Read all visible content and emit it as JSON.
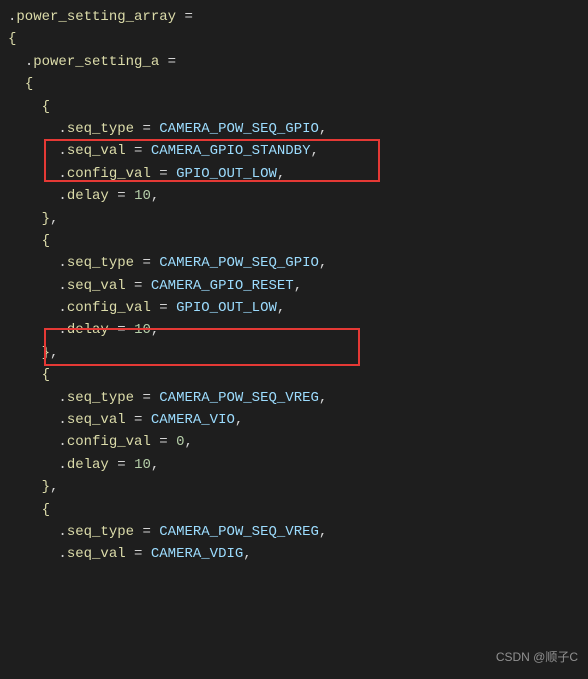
{
  "lines": [
    {
      "indent": 0,
      "type": "assign",
      "member": "power_setting_array"
    },
    {
      "indent": 0,
      "type": "open-brace"
    },
    {
      "indent": 1,
      "type": "assign",
      "member": "power_setting_a"
    },
    {
      "indent": 1,
      "type": "open-brace"
    },
    {
      "indent": 2,
      "type": "open-brace"
    },
    {
      "indent": 3,
      "type": "kv",
      "member": "seq_type",
      "value": "CAMERA_POW_SEQ_GPIO"
    },
    {
      "indent": 3,
      "type": "kv",
      "member": "seq_val",
      "value": "CAMERA_GPIO_STANDBY"
    },
    {
      "indent": 3,
      "type": "kv",
      "member": "config_val",
      "value": "GPIO_OUT_LOW"
    },
    {
      "indent": 3,
      "type": "kvnum",
      "member": "delay",
      "value": "10"
    },
    {
      "indent": 2,
      "type": "close-brace-comma"
    },
    {
      "indent": 2,
      "type": "open-brace"
    },
    {
      "indent": 3,
      "type": "kv",
      "member": "seq_type",
      "value": "CAMERA_POW_SEQ_GPIO"
    },
    {
      "indent": 3,
      "type": "kv",
      "member": "seq_val",
      "value": "CAMERA_GPIO_RESET"
    },
    {
      "indent": 3,
      "type": "kv",
      "member": "config_val",
      "value": "GPIO_OUT_LOW"
    },
    {
      "indent": 3,
      "type": "kvnum",
      "member": "delay",
      "value": "10"
    },
    {
      "indent": 2,
      "type": "close-brace-comma"
    },
    {
      "indent": 2,
      "type": "open-brace"
    },
    {
      "indent": 3,
      "type": "kv",
      "member": "seq_type",
      "value": "CAMERA_POW_SEQ_VREG"
    },
    {
      "indent": 3,
      "type": "kv",
      "member": "seq_val",
      "value": "CAMERA_VIO"
    },
    {
      "indent": 3,
      "type": "kvnum",
      "member": "config_val",
      "value": "0"
    },
    {
      "indent": 3,
      "type": "kvnum",
      "member": "delay",
      "value": "10"
    },
    {
      "indent": 2,
      "type": "close-brace-comma"
    },
    {
      "indent": 2,
      "type": "open-brace"
    },
    {
      "indent": 3,
      "type": "kv",
      "member": "seq_type",
      "value": "CAMERA_POW_SEQ_VREG"
    },
    {
      "indent": 3,
      "type": "kv",
      "member": "seq_val",
      "value": "CAMERA_VDIG"
    }
  ],
  "watermark": "CSDN @顺子C"
}
